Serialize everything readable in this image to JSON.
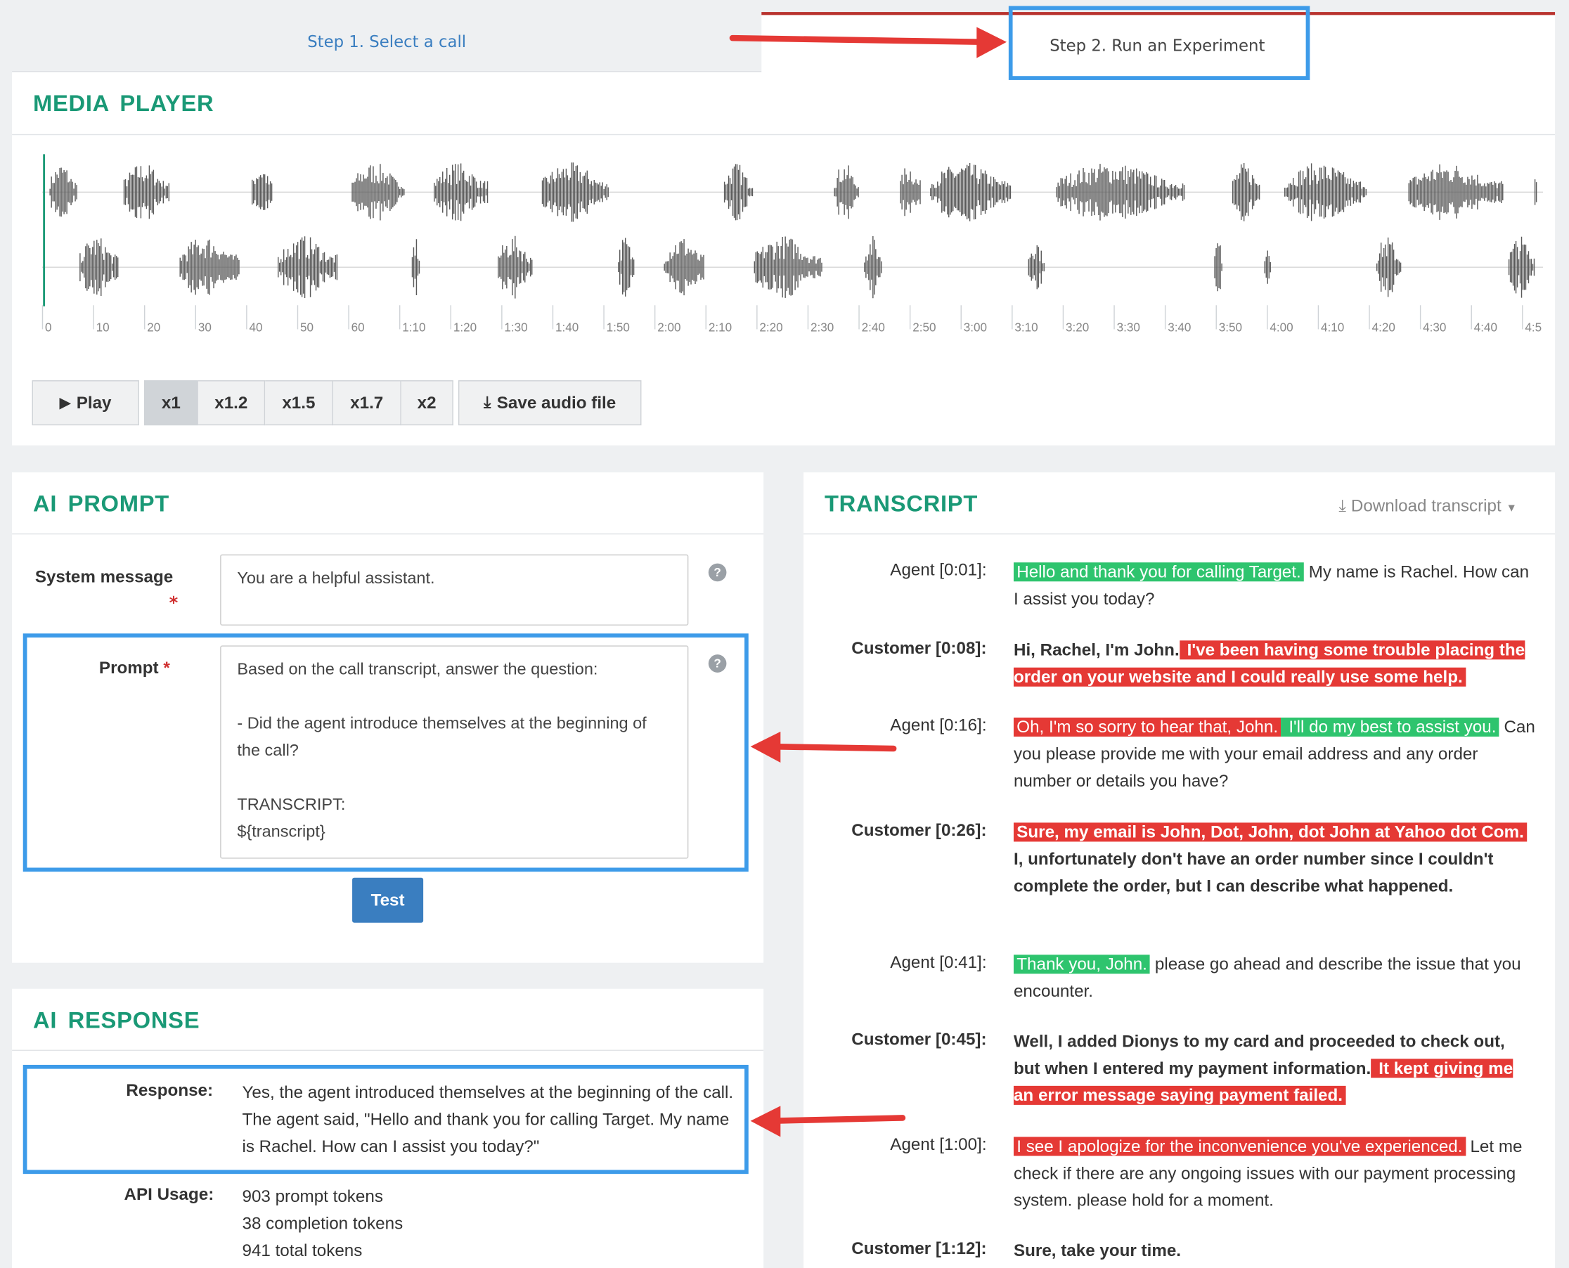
{
  "tabs": [
    {
      "label": "Step 1. Select a call",
      "active": false
    },
    {
      "label": "Step 2. Run an Experiment",
      "active": true
    }
  ],
  "media_player": {
    "title": "MEDIA PLAYER",
    "timeline_labels": [
      "0",
      "10",
      "20",
      "30",
      "40",
      "50",
      "60",
      "1:10",
      "1:20",
      "1:30",
      "1:40",
      "1:50",
      "2:00",
      "2:10",
      "2:20",
      "2:30",
      "2:40",
      "2:50",
      "3:00",
      "3:10",
      "3:20",
      "3:30",
      "3:40",
      "3:50",
      "4:00",
      "4:10",
      "4:20",
      "4:30",
      "4:40",
      "4:5"
    ],
    "play_label": "Play",
    "speeds": [
      "x1",
      "x1.2",
      "x1.5",
      "x1.7",
      "x2"
    ],
    "active_speed": "x1",
    "save_label": "Save audio file"
  },
  "ai_prompt": {
    "title": "AI PROMPT",
    "system_label": "System message",
    "system_value": "You are a helpful assistant.",
    "prompt_label": "Prompt",
    "required_mark": "*",
    "prompt_value": "Based on the call transcript, answer the question:\n\n- Did the agent introduce themselves at the beginning of the call?\n\nTRANSCRIPT:\n${transcript}",
    "help_glyph": "?",
    "test_label": "Test"
  },
  "ai_response": {
    "title": "AI RESPONSE",
    "response_label": "Response:",
    "response_text": "Yes, the agent introduced themselves at the beginning of the call. The agent said, \"Hello and thank you for calling Target. My name is Rachel. How can I assist you today?\"",
    "usage_label": "API Usage:",
    "usage_lines": [
      "903 prompt tokens",
      "38 completion tokens",
      "941 total tokens"
    ]
  },
  "transcript": {
    "title": "TRANSCRIPT",
    "download_label": "Download transcript",
    "colors": {
      "good": "#2ec46e",
      "bad": "#e53935"
    },
    "entries": [
      {
        "speaker": "Agent [0:01]:",
        "role": "agent",
        "segments": [
          {
            "text": "Hello and thank you for calling Target.",
            "hl": "green"
          },
          {
            "text": " My name is Rachel. How can I assist you today?",
            "hl": ""
          }
        ]
      },
      {
        "speaker": "Customer [0:08]:",
        "role": "customer",
        "segments": [
          {
            "text": "Hi, Rachel, I'm John.",
            "hl": ""
          },
          {
            "text": " I've been having some trouble placing the order on your website and I could really use some help.",
            "hl": "red"
          }
        ]
      },
      {
        "speaker": "Agent [0:16]:",
        "role": "agent",
        "segments": [
          {
            "text": "Oh, I'm so sorry to hear that, John.",
            "hl": "red"
          },
          {
            "text": " I'll do my best to assist you.",
            "hl": "green"
          },
          {
            "text": " Can you please provide me with your email address and any order number or details you have?",
            "hl": ""
          }
        ]
      },
      {
        "speaker": "Customer [0:26]:",
        "role": "customer",
        "segments": [
          {
            "text": "Sure, my email is John, Dot, John, dot John at Yahoo dot Com.",
            "hl": "red"
          },
          {
            "text": " I, unfortunately don't have an order number since I couldn't complete the order, but I can describe what happened.",
            "hl": ""
          }
        ]
      },
      {
        "speaker": "Agent [0:41]:",
        "role": "agent",
        "segments": [
          {
            "text": "Thank you, John.",
            "hl": "green"
          },
          {
            "text": " please go ahead and describe the issue that you encounter.",
            "hl": ""
          }
        ]
      },
      {
        "speaker": "Customer [0:45]:",
        "role": "customer",
        "segments": [
          {
            "text": "Well, I added Dionys to my card and proceeded to check out, but when I entered my payment information.",
            "hl": ""
          },
          {
            "text": " It kept giving me an error message saying payment failed.",
            "hl": "red"
          }
        ]
      },
      {
        "speaker": "Agent [1:00]:",
        "role": "agent",
        "segments": [
          {
            "text": "I see I apologize for the inconvenience you've experienced.",
            "hl": "red"
          },
          {
            "text": " Let me check if there are any ongoing issues with our payment processing system. please hold for a moment.",
            "hl": ""
          }
        ]
      },
      {
        "speaker": "Customer [1:12]:",
        "role": "customer",
        "segments": [
          {
            "text": "Sure, take your time.",
            "hl": ""
          }
        ]
      }
    ]
  }
}
